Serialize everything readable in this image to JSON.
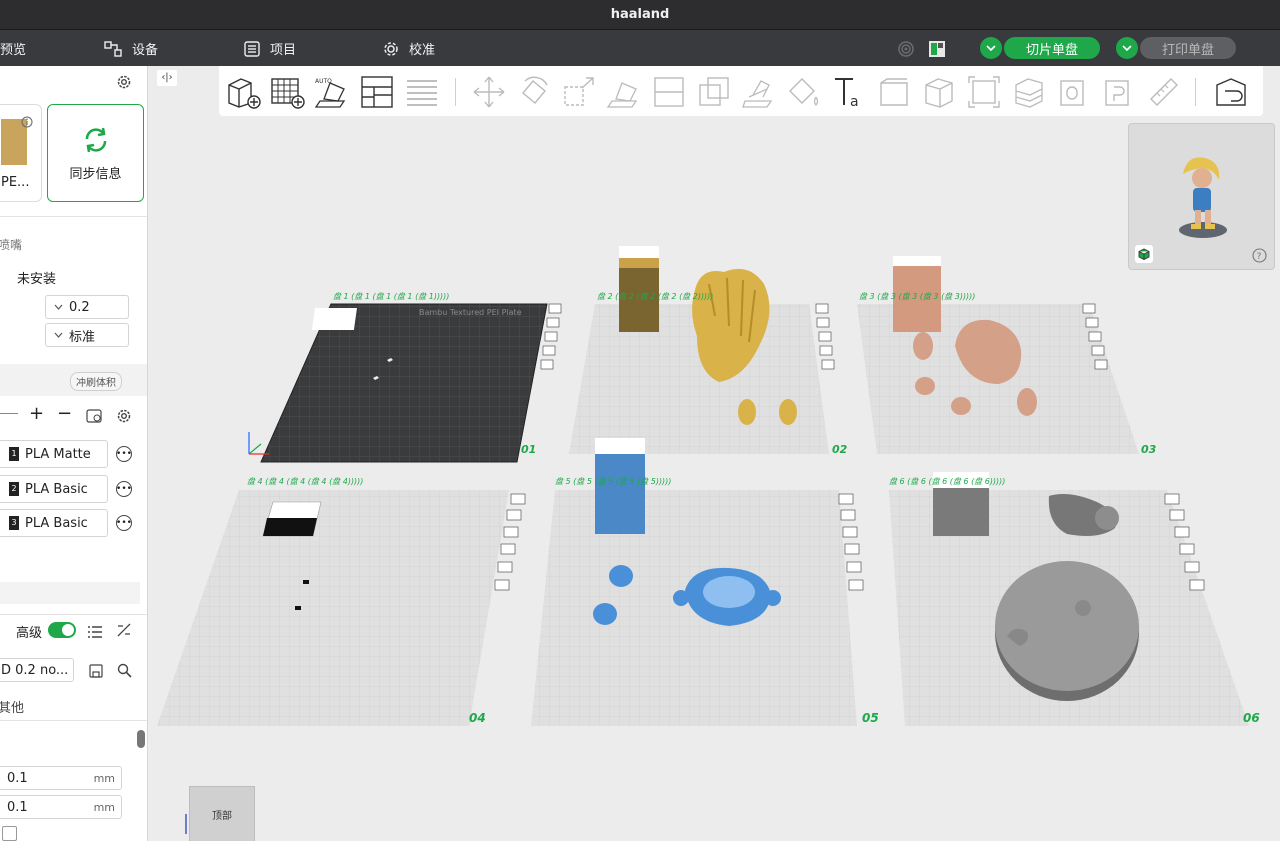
{
  "window": {
    "title": "haaland"
  },
  "menubar": {
    "items": [
      {
        "label": "预览",
        "icon": "preview-icon"
      },
      {
        "label": "设备",
        "icon": "device-icon"
      },
      {
        "label": "项目",
        "icon": "project-icon"
      },
      {
        "label": "校准",
        "icon": "calibration-icon"
      }
    ],
    "slice_label": "切片单盘",
    "print_label": "打印单盘",
    "accent": "#1ea84a"
  },
  "left_panel": {
    "plate_card_label": "PE...",
    "sync_label": "同步信息",
    "nozzle_section": "喷嘴",
    "nozzle_status": "未安装",
    "nozzle_diameter": "0.2",
    "nozzle_type": "标准",
    "flush_volume_label": "冲刷体积",
    "filaments": [
      {
        "name": "PLA Matte",
        "slot": "1"
      },
      {
        "name": "PLA Basic",
        "slot": "2"
      },
      {
        "name": "PLA Basic",
        "slot": "3"
      }
    ],
    "advanced_label": "高级",
    "advanced_on": true,
    "process_preset": "D 0.2 no...",
    "other_tab": "其他",
    "param_1": "0.1",
    "param_2": "0.1",
    "unit": "mm"
  },
  "viewport": {
    "collapse_label": "‹|›",
    "view_label": "顶部",
    "plates": [
      {
        "number": "01",
        "name": "盘 1 (盘 1 (盘 1 (盘 1 (盘 1)))))"
      },
      {
        "number": "02",
        "name": "盘 2 (盘 2 (盘 2 (盘 2 (盘 2)))))"
      },
      {
        "number": "03",
        "name": "盘 3 (盘 3 (盘 3 (盘 3 (盘 3)))))"
      },
      {
        "number": "04",
        "name": "盘 4 (盘 4 (盘 4 (盘 4 (盘 4)))))"
      },
      {
        "number": "05",
        "name": "盘 5 (盘 5 (盘 5 (盘 5 (盘 5)))))"
      },
      {
        "number": "06",
        "name": "盘 6 (盘 6 (盘 6 (盘 6 (盘 6)))))"
      }
    ],
    "bed_text": "Bambu Textured PEI Plate"
  }
}
